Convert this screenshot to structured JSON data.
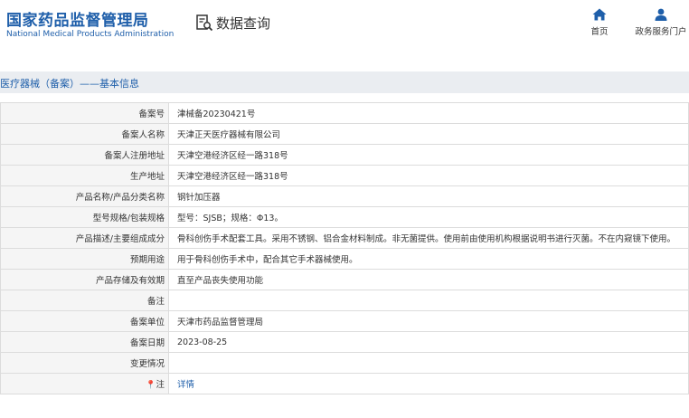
{
  "header": {
    "logo_cn": "国家药品监督管理局",
    "logo_en": "National Medical Products Administration",
    "query_label": "数据查询",
    "nav": [
      {
        "label": "首页",
        "icon": "home-icon"
      },
      {
        "label": "政务服务门户",
        "icon": "user-icon"
      }
    ]
  },
  "breadcrumb": "医疗器械（备案）——基本信息",
  "colors": {
    "brand": "#1f5faa",
    "label_bg": "#f5f5f5",
    "border": "#dcdcdc",
    "crumb_bg": "#eaedf1"
  },
  "rows": [
    {
      "label": "备案号",
      "value": "津械备20230421号"
    },
    {
      "label": "备案人名称",
      "value": "天津正天医疗器械有限公司"
    },
    {
      "label": "备案人注册地址",
      "value": "天津空港经济区经一路318号"
    },
    {
      "label": "生产地址",
      "value": "天津空港经济区经一路318号"
    },
    {
      "label": "产品名称/产品分类名称",
      "value": "钢针加压器"
    },
    {
      "label": "型号规格/包装规格",
      "value": "型号：SJSB；规格：Φ13。"
    },
    {
      "label": "产品描述/主要组成成分",
      "value": "骨科创伤手术配套工具。采用不锈钢、铝合金材料制成。非无菌提供。使用前由使用机构根据说明书进行灭菌。不在内窥镜下使用。"
    },
    {
      "label": "预期用途",
      "value": "用于骨科创伤手术中，配合其它手术器械使用。"
    },
    {
      "label": "产品存储及有效期",
      "value": "直至产品丧失使用功能"
    },
    {
      "label": "备注",
      "value": ""
    },
    {
      "label": "备案单位",
      "value": "天津市药品监督管理局"
    },
    {
      "label": "备案日期",
      "value": "2023-08-25"
    },
    {
      "label": "变更情况",
      "value": ""
    }
  ],
  "note_row": {
    "pin": "📍",
    "label": "注",
    "link": "详情"
  }
}
